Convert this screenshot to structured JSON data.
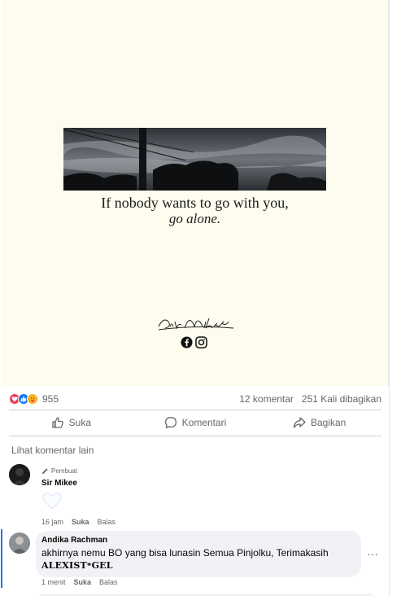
{
  "post": {
    "quote_line1": "If nobody wants to go with you,",
    "quote_line2": "go alone.",
    "signature": "Sir Mikee",
    "background_color": "#fdfcee"
  },
  "stats": {
    "reactions": [
      "like-icon",
      "love-icon",
      "care-icon"
    ],
    "reaction_count": "955",
    "comments": "12 komentar",
    "shares": "251 Kali dibagikan"
  },
  "actions": {
    "like": "Suka",
    "comment": "Komentari",
    "share": "Bagikan"
  },
  "more_comments": "Lihat komentar lain",
  "comments": [
    {
      "badge": "Pembuat",
      "name": "Sir Mikee",
      "sticker": "heart-sticker",
      "time": "16 jam",
      "like": "Suka",
      "reply": "Balas"
    },
    {
      "name": "Andika Rachman",
      "text": "akhirnya nemu BO yang bisa lunasin Semua Pinjolku, Terimakasih",
      "text2": "𝐀𝐋𝐄𝐗𝐈𝐒𝐓*𝐆𝐄𝐋",
      "time": "1 menit",
      "like": "Suka",
      "reply": "Balas",
      "more": "···"
    }
  ],
  "colors": {
    "accent": "#1877f2",
    "muted_text": "#65676b",
    "bubble": "#f0f2f5"
  }
}
